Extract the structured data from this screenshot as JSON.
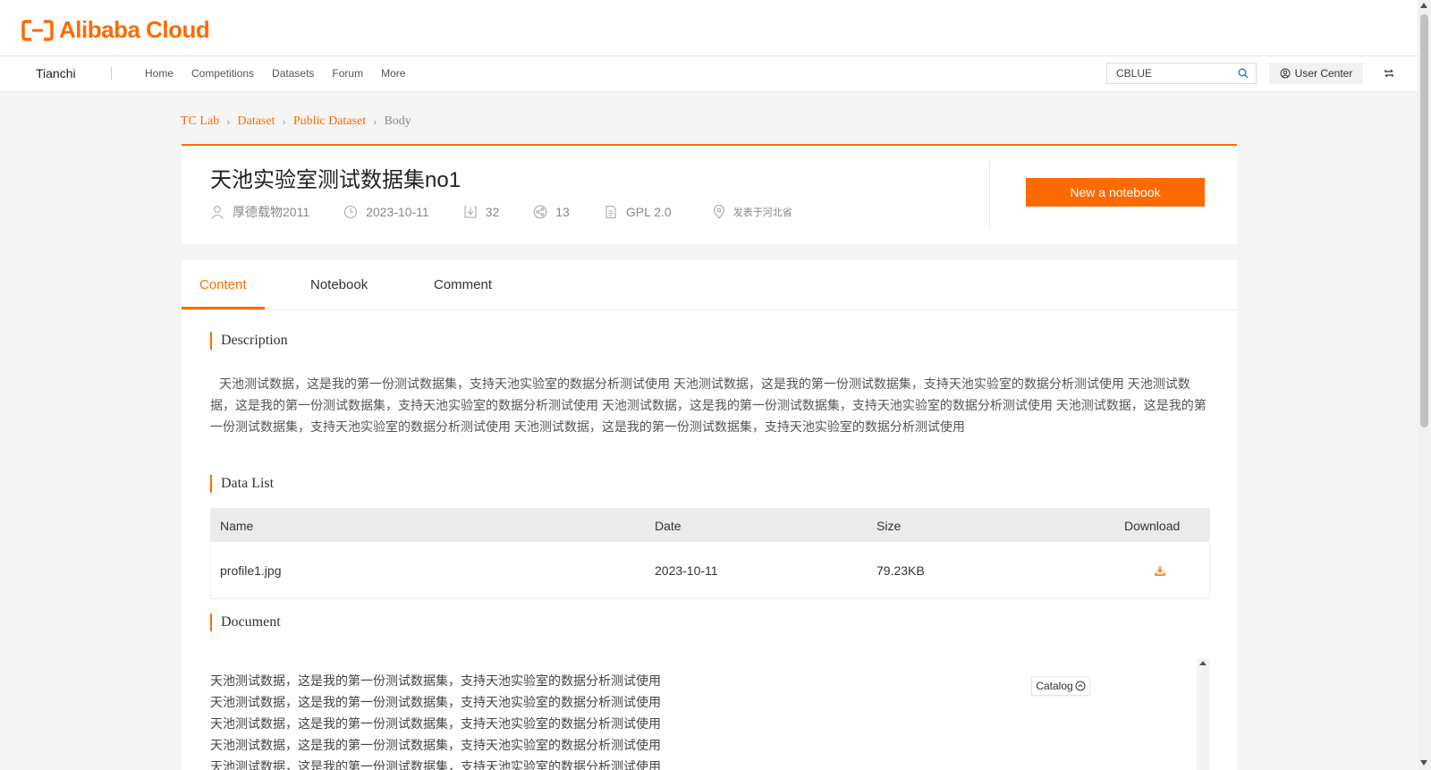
{
  "brand": {
    "logo_text": "Alibaba Cloud",
    "logo_color": "#ff6a00"
  },
  "nav": {
    "brand": "Tianchi",
    "links": [
      "Home",
      "Competitions",
      "Datasets",
      "Forum",
      "More"
    ],
    "search_value": "CBLUE",
    "user_center": "User Center"
  },
  "breadcrumb": [
    "TC Lab",
    "Dataset",
    "Public Dataset",
    "Body"
  ],
  "dataset": {
    "title": "天池实验室测试数据集no1",
    "author": "厚德载物2011",
    "date": "2023-10-11",
    "downloads": "32",
    "shares": "13",
    "license": "GPL 2.0",
    "location": "发表于河北省",
    "new_notebook": "New a notebook"
  },
  "tabs": [
    "Content",
    "Notebook",
    "Comment"
  ],
  "sections": {
    "description": "Description",
    "data_list": "Data List",
    "document": "Document"
  },
  "description_text": "天池测试数据，这是我的第一份测试数据集，支持天池实验室的数据分析测试使用 天池测试数据，这是我的第一份测试数据集，支持天池实验室的数据分析测试使用 天池测试数据，这是我的第一份测试数据集，支持天池实验室的数据分析测试使用 天池测试数据，这是我的第一份测试数据集，支持天池实验室的数据分析测试使用 天池测试数据，这是我的第一份测试数据集，支持天池实验室的数据分析测试使用 天池测试数据，这是我的第一份测试数据集，支持天池实验室的数据分析测试使用",
  "table": {
    "headers": [
      "Name",
      "Date",
      "Size",
      "Download"
    ],
    "rows": [
      {
        "name": "profile1.jpg",
        "date": "2023-10-11",
        "size": "79.23KB"
      }
    ]
  },
  "document_lines": [
    "天池测试数据，这是我的第一份测试数据集，支持天池实验室的数据分析测试使用",
    "天池测试数据，这是我的第一份测试数据集，支持天池实验室的数据分析测试使用",
    "天池测试数据，这是我的第一份测试数据集，支持天池实验室的数据分析测试使用",
    "天池测试数据，这是我的第一份测试数据集，支持天池实验室的数据分析测试使用",
    "天池测试数据，这是我的第一份测试数据集，支持天池实验室的数据分析测试使用"
  ],
  "catalog": "Catalog",
  "icons": {
    "search": "search-icon",
    "user": "user-icon",
    "clock": "clock-icon",
    "download": "download-icon",
    "share": "share-icon",
    "license": "document-icon",
    "location": "location-icon",
    "catalog": "chevron-up-circle-icon",
    "swap": "swap-icon"
  }
}
